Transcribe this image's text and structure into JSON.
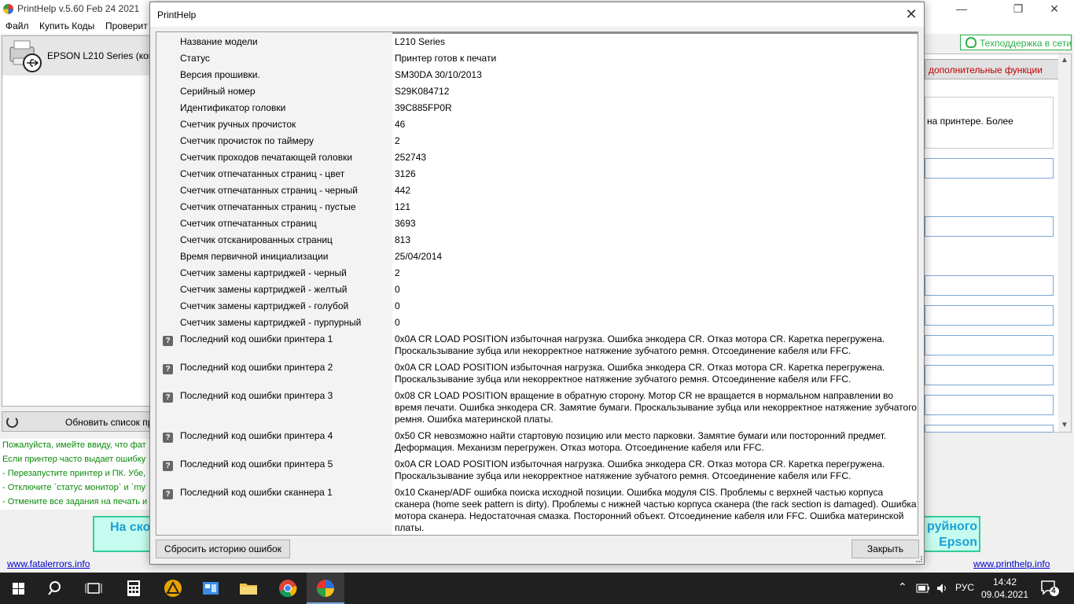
{
  "main": {
    "title": "PrintHelp v.5.60 Feb 24 2021",
    "menu": [
      "Файл",
      "Купить Коды",
      "Проверит"
    ],
    "controls": {
      "minimize": "—",
      "maximize": "❐",
      "close": "✕"
    },
    "printer_name": "EPSON L210 Series (копи",
    "refresh_label": "Обновить список пр",
    "info_lines": [
      "Пожалуйста, имейте ввиду, что фат",
      "Если принтер часто выдает ошибку",
      "- Перезапустите принтер и ПК. Убе,",
      "- Отключите `статус монитор` и `my",
      "- Отмените все задания на печать и"
    ],
    "banner_left": "На ско",
    "banner_right_1": "руйного",
    "banner_right_2": "Epson",
    "link_left": "www.fatalerrors.info",
    "link_right": "www.printhelp.info",
    "support_label": "Техподдержка в сети",
    "extra_functions": "дополнительные функции",
    "right_text": "на принтере. Более"
  },
  "dialog": {
    "title": "PrintHelp",
    "close_glyph": "✕",
    "help_glyph": "?",
    "rows": [
      {
        "label": "Название модели",
        "value": "L210 Series"
      },
      {
        "label": "Статус",
        "value": "Принтер готов к печати"
      },
      {
        "label": "Версия прошивки.",
        "value": "SM30DA 30/10/2013"
      },
      {
        "label": "Серийный номер",
        "value": "S29K084712"
      },
      {
        "label": "Идентификатор головки",
        "value": "39C885FP0R"
      },
      {
        "label": "Счетчик ручных прочисток",
        "value": "46"
      },
      {
        "label": "Счетчик прочисток по таймеру",
        "value": "2"
      },
      {
        "label": "Счетчик проходов печатающей головки",
        "value": "252743"
      },
      {
        "label": "Счетчик отпечатанных страниц - цвет",
        "value": "3126"
      },
      {
        "label": "Счетчик отпечатанных страниц - черный",
        "value": "442"
      },
      {
        "label": "Счетчик отпечатанных страниц - пустые",
        "value": "121"
      },
      {
        "label": "Счетчик отпечатанных страниц",
        "value": "3693"
      },
      {
        "label": "Счетчик отсканированных страниц",
        "value": "813"
      },
      {
        "label": "Время первичной инициализации",
        "value": "25/04/2014"
      },
      {
        "label": "Счетчик замены картриджей - черный",
        "value": "2"
      },
      {
        "label": "Счетчик замены картриджей - желтый",
        "value": "0"
      },
      {
        "label": "Счетчик замены картриджей - голубой",
        "value": "0"
      },
      {
        "label": "Счетчик замены картриджей - пурпурный",
        "value": "0"
      },
      {
        "label": "Последний код ошибки принтера 1",
        "value": "0x0A CR LOAD POSITION избыточная нагрузка. Ошибка энкодера CR. Отказ мотора CR. Каретка перегружена. Проскальзывание зубца или некорректное натяжение зубчатого ремня. Отсоединение кабеля или FFC."
      },
      {
        "label": "Последний код ошибки принтера 2",
        "value": "0x0A CR LOAD POSITION избыточная нагрузка. Ошибка энкодера CR. Отказ мотора CR. Каретка перегружена. Проскальзывание зубца или некорректное натяжение зубчатого ремня. Отсоединение кабеля или FFC."
      },
      {
        "label": "Последний код ошибки принтера 3",
        "value": "0x08 CR LOAD POSITION вращение в обратную сторону. Мотор CR не вращается в нормальном направлении во время печати. Ошибка энкодера CR. Замятие бумаги. Проскальзывание зубца или некорректное натяжение зубчатого ремня. Ошибка материнской платы."
      },
      {
        "label": "Последний код ошибки принтера 4",
        "value": "0x50 CR невозможно найти стартовую позицию или место парковки. Замятие бумаги или посторонний предмет. Деформация. Механизм перегружен. Отказ мотора. Отсоединение кабеля или FFC."
      },
      {
        "label": "Последний код ошибки принтера 5",
        "value": "0x0A CR LOAD POSITION избыточная нагрузка. Ошибка энкодера CR. Отказ мотора CR. Каретка перегружена. Проскальзывание зубца или некорректное натяжение зубчатого ремня. Отсоединение кабеля или FFC."
      },
      {
        "label": "Последний код ошибки сканнера 1",
        "value": "0x10 Сканер/ADF ошибка поиска исходной позиции. Ошибка модуля CIS. Проблемы с верхней частью корпуса сканера (home seek pattern is dirty). Проблемы с нижней частью корпуса сканера (the rack section is damaged). Ошибка мотора сканера. Недостаточная смазка. Посторонний объект. Отсоединение кабеля или FFC. Ошибка материнской платы."
      }
    ],
    "reset_button": "Сбросить историю ошибок",
    "close_button": "Закрыть"
  },
  "taskbar": {
    "time": "14:42",
    "date": "09.04.2021",
    "lang": "РУС",
    "notifications": "4"
  }
}
